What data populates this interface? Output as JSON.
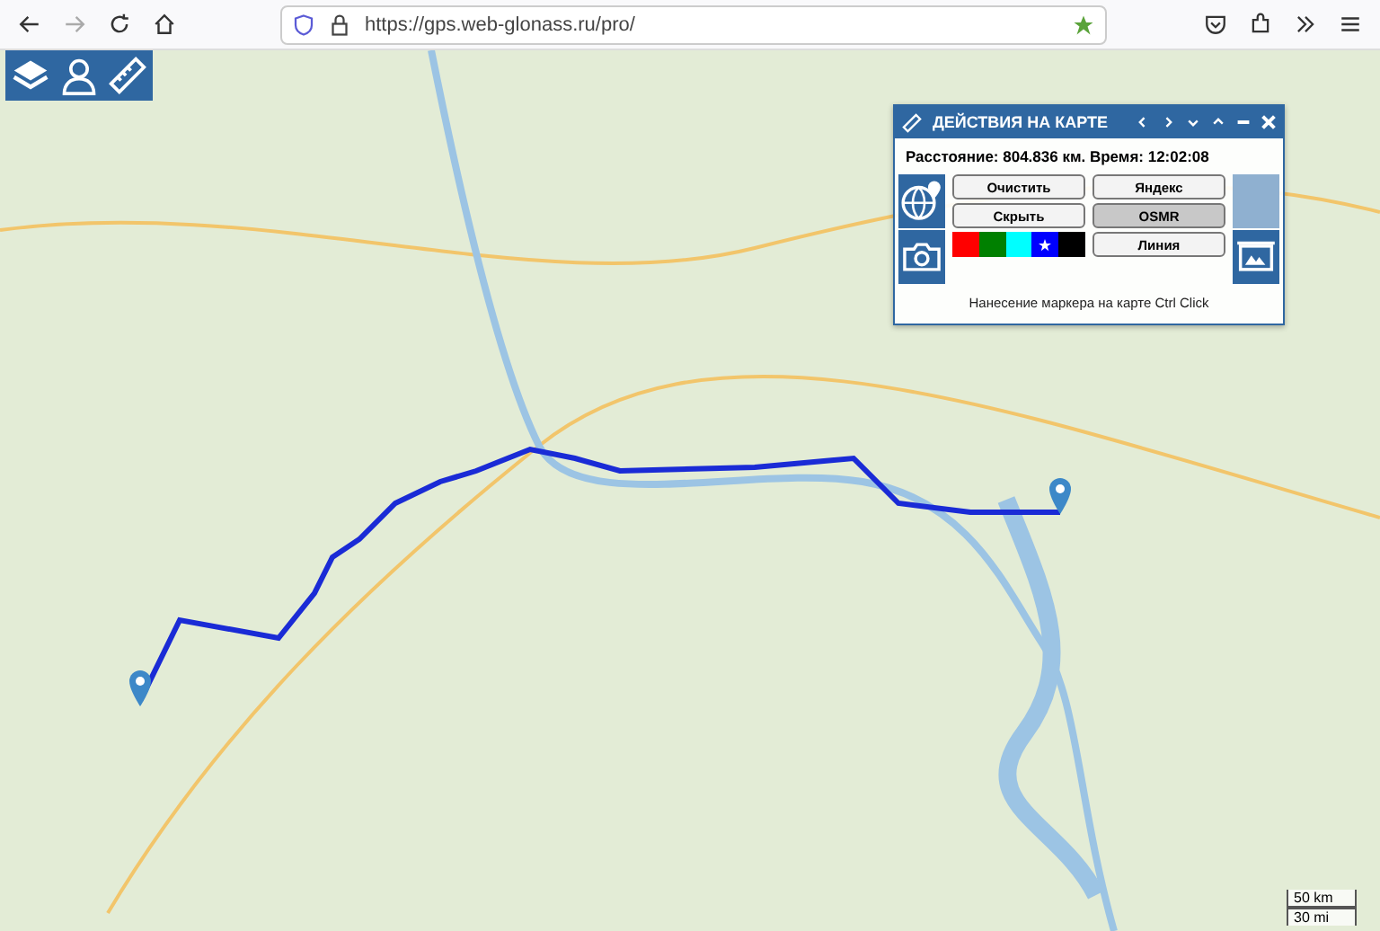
{
  "browser": {
    "url": "https://gps.web-glonass.ru/pro/",
    "bookmarked": true
  },
  "panel": {
    "title": "ДЕЙСТВИЯ НА КАРТЕ",
    "summary": "Расстояние: 804.836 км. Время: 12:02:08",
    "buttons": [
      {
        "label": "Очистить",
        "selected": false
      },
      {
        "label": "Скрыть",
        "selected": false
      },
      {
        "label": "Яндекс",
        "selected": false
      },
      {
        "label": "OSMR",
        "selected": true
      },
      {
        "label": "Линия",
        "selected": false
      }
    ],
    "colors": [
      {
        "color": "#ff0000",
        "selected": false
      },
      {
        "color": "#008000",
        "selected": false
      },
      {
        "color": "#00ffff",
        "selected": false
      },
      {
        "color": "#0000ff",
        "selected": true
      },
      {
        "color": "#000000",
        "selected": false
      }
    ],
    "hint": "Нанесение маркера на карте Ctrl Click"
  },
  "scale": {
    "metric": "50 km",
    "imperial": "30 mi"
  }
}
